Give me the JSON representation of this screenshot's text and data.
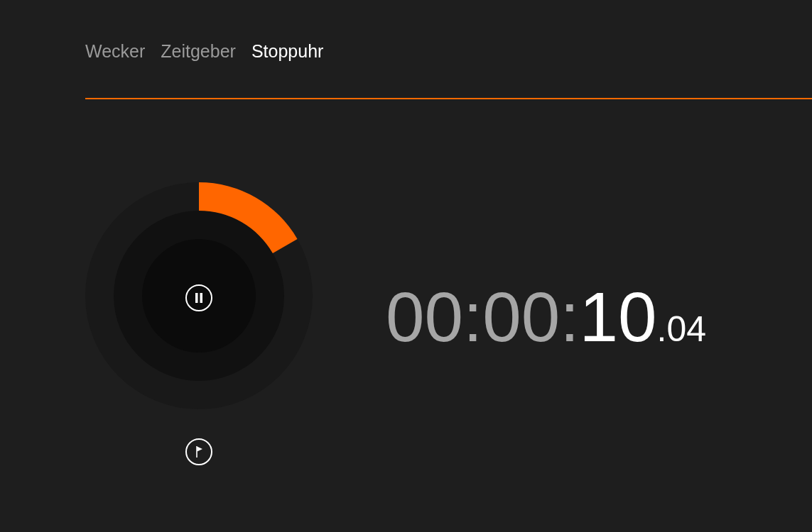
{
  "tabs": [
    {
      "label": "Wecker",
      "selected": false
    },
    {
      "label": "Zeitgeber",
      "selected": false
    },
    {
      "label": "Stoppuhr",
      "selected": true
    }
  ],
  "stopwatch": {
    "running": true,
    "elapsed_dim": "00:00:",
    "elapsed_main": "10",
    "fraction": ".04"
  }
}
